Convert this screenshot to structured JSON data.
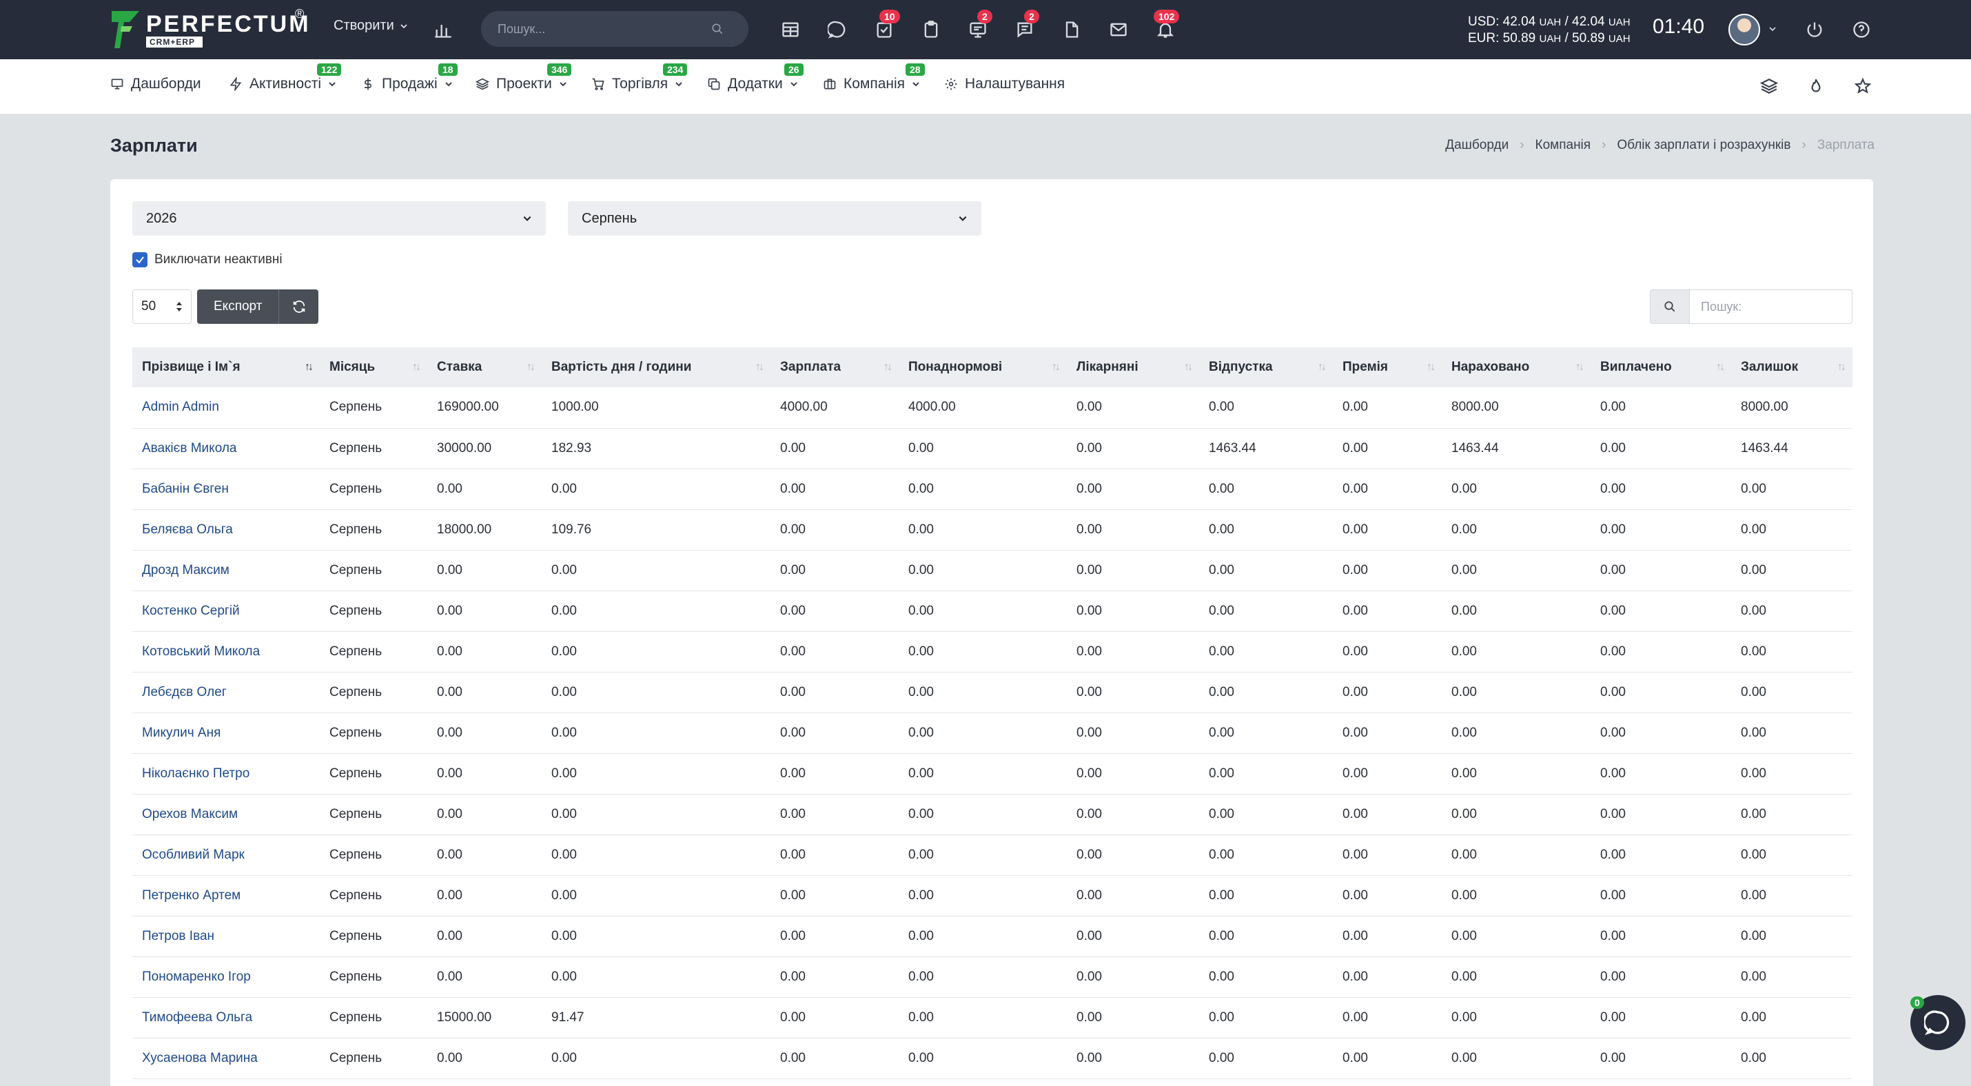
{
  "topbar": {
    "logo_word": "PERFECTUM",
    "logo_sub": "CRM+ERP",
    "logo_reg": "®",
    "create_label": "Створити",
    "search_placeholder": "Пошук...",
    "badges": {
      "tasks": "10",
      "chat": "2",
      "messages": "2",
      "notifications": "102"
    },
    "currency_usd": "USD: 42.04",
    "currency_usd_unit1": "UAH",
    "currency_usd_sep": "/ 42.04",
    "currency_usd_unit2": "UAH",
    "currency_eur": "EUR: 50.89",
    "currency_eur_unit1": "UAH",
    "currency_eur_sep": "/ 50.89",
    "currency_eur_unit2": "UAH",
    "clock": "01:40"
  },
  "nav": [
    {
      "label": "Дашборди",
      "badge": "",
      "icon": "monitor-icon"
    },
    {
      "label": "Активності",
      "badge": "122",
      "icon": "lightning-icon"
    },
    {
      "label": "Продажі",
      "badge": "18",
      "icon": "dollar-icon"
    },
    {
      "label": "Проекти",
      "badge": "346",
      "icon": "layers-icon"
    },
    {
      "label": "Торгівля",
      "badge": "234",
      "icon": "cart-icon"
    },
    {
      "label": "Додатки",
      "badge": "26",
      "icon": "copy-icon"
    },
    {
      "label": "Компанія",
      "badge": "28",
      "icon": "briefcase-icon"
    },
    {
      "label": "Налаштування",
      "badge": "",
      "icon": "gear-icon"
    }
  ],
  "page": {
    "title": "Зарплати",
    "breadcrumb": [
      "Дашборди",
      "Компанія",
      "Облік зарплати і розрахунків",
      "Зарплата"
    ]
  },
  "filters": {
    "year": "2026",
    "month": "Серпень",
    "include_inactive": "Виключати неактивні",
    "page_length": "50",
    "export_label": "Експорт",
    "search_placeholder": "Пошук:"
  },
  "table": {
    "columns": [
      "Прізвище і Ім`я",
      "Місяць",
      "Ставка",
      "Вартість дня / години",
      "Зарплата",
      "Понаднормові",
      "Лікарняні",
      "Відпустка",
      "Премія",
      "Нараховано",
      "Виплачено",
      "Залишок"
    ],
    "rows": [
      [
        "Admin Admin",
        "Серпень",
        "169000.00",
        "1000.00",
        "4000.00",
        "4000.00",
        "0.00",
        "0.00",
        "0.00",
        "8000.00",
        "0.00",
        "8000.00"
      ],
      [
        "Авакієв Микола",
        "Серпень",
        "30000.00",
        "182.93",
        "0.00",
        "0.00",
        "0.00",
        "1463.44",
        "0.00",
        "1463.44",
        "0.00",
        "1463.44"
      ],
      [
        "Бабанін Євген",
        "Серпень",
        "0.00",
        "0.00",
        "0.00",
        "0.00",
        "0.00",
        "0.00",
        "0.00",
        "0.00",
        "0.00",
        "0.00"
      ],
      [
        "Беляєва Ольга",
        "Серпень",
        "18000.00",
        "109.76",
        "0.00",
        "0.00",
        "0.00",
        "0.00",
        "0.00",
        "0.00",
        "0.00",
        "0.00"
      ],
      [
        "Дрозд Максим",
        "Серпень",
        "0.00",
        "0.00",
        "0.00",
        "0.00",
        "0.00",
        "0.00",
        "0.00",
        "0.00",
        "0.00",
        "0.00"
      ],
      [
        "Костенко Сергій",
        "Серпень",
        "0.00",
        "0.00",
        "0.00",
        "0.00",
        "0.00",
        "0.00",
        "0.00",
        "0.00",
        "0.00",
        "0.00"
      ],
      [
        "Котовський Микола",
        "Серпень",
        "0.00",
        "0.00",
        "0.00",
        "0.00",
        "0.00",
        "0.00",
        "0.00",
        "0.00",
        "0.00",
        "0.00"
      ],
      [
        "Лебєдєв Олег",
        "Серпень",
        "0.00",
        "0.00",
        "0.00",
        "0.00",
        "0.00",
        "0.00",
        "0.00",
        "0.00",
        "0.00",
        "0.00"
      ],
      [
        "Микулич Аня",
        "Серпень",
        "0.00",
        "0.00",
        "0.00",
        "0.00",
        "0.00",
        "0.00",
        "0.00",
        "0.00",
        "0.00",
        "0.00"
      ],
      [
        "Ніколаєнко Петро",
        "Серпень",
        "0.00",
        "0.00",
        "0.00",
        "0.00",
        "0.00",
        "0.00",
        "0.00",
        "0.00",
        "0.00",
        "0.00"
      ],
      [
        "Орехов Максим",
        "Серпень",
        "0.00",
        "0.00",
        "0.00",
        "0.00",
        "0.00",
        "0.00",
        "0.00",
        "0.00",
        "0.00",
        "0.00"
      ],
      [
        "Особливий Марк",
        "Серпень",
        "0.00",
        "0.00",
        "0.00",
        "0.00",
        "0.00",
        "0.00",
        "0.00",
        "0.00",
        "0.00",
        "0.00"
      ],
      [
        "Петренко Артем",
        "Серпень",
        "0.00",
        "0.00",
        "0.00",
        "0.00",
        "0.00",
        "0.00",
        "0.00",
        "0.00",
        "0.00",
        "0.00"
      ],
      [
        "Петров Іван",
        "Серпень",
        "0.00",
        "0.00",
        "0.00",
        "0.00",
        "0.00",
        "0.00",
        "0.00",
        "0.00",
        "0.00",
        "0.00"
      ],
      [
        "Пономаренко Ігор",
        "Серпень",
        "0.00",
        "0.00",
        "0.00",
        "0.00",
        "0.00",
        "0.00",
        "0.00",
        "0.00",
        "0.00",
        "0.00"
      ],
      [
        "Тимофеева Ольга",
        "Серпень",
        "15000.00",
        "91.47",
        "0.00",
        "0.00",
        "0.00",
        "0.00",
        "0.00",
        "0.00",
        "0.00",
        "0.00"
      ],
      [
        "Хусаенова Марина",
        "Серпень",
        "0.00",
        "0.00",
        "0.00",
        "0.00",
        "0.00",
        "0.00",
        "0.00",
        "0.00",
        "0.00",
        "0.00"
      ]
    ]
  },
  "chat": {
    "badge": "0"
  },
  "colors": {
    "topbar": "#262c3a",
    "accent_green": "#2aa745",
    "badge_red": "#e8324d",
    "link": "#1f4a8a",
    "checkbox": "#2c66c9"
  }
}
